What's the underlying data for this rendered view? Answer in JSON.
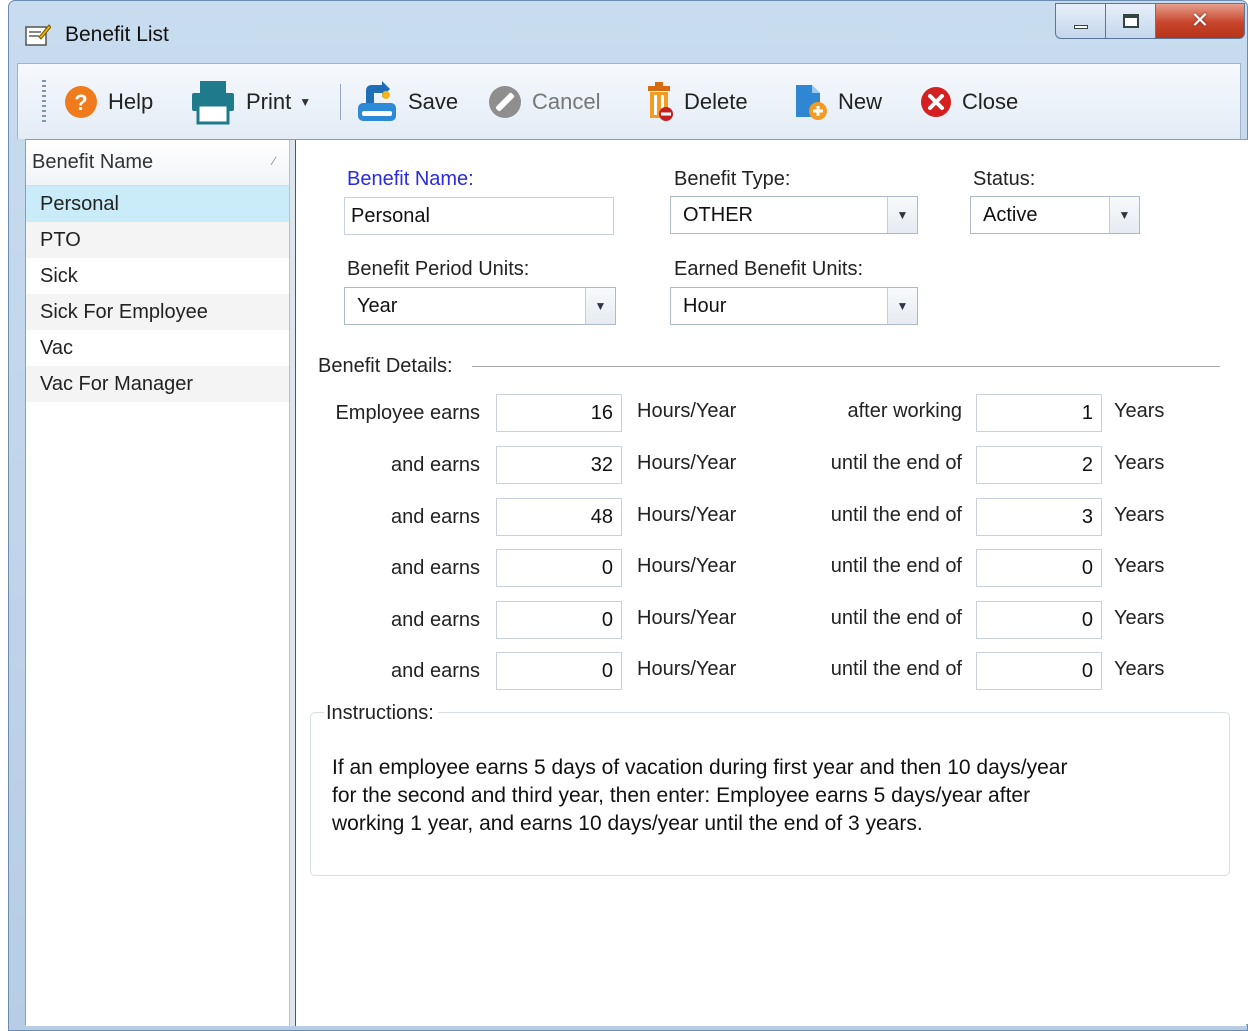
{
  "window": {
    "title": "Benefit List",
    "accent_color": "#c7452b"
  },
  "toolbar": {
    "help": "Help",
    "print": "Print",
    "save": "Save",
    "cancel": "Cancel",
    "delete": "Delete",
    "new": "New",
    "close": "Close"
  },
  "list": {
    "header": "Benefit Name",
    "items": [
      "Personal",
      "PTO",
      "Sick",
      "Sick For Employee",
      "Vac",
      "Vac For Manager"
    ],
    "selected": "Personal"
  },
  "form": {
    "benefit_name_label": "Benefit Name:",
    "benefit_name_value": "Personal",
    "benefit_type_label": "Benefit Type:",
    "benefit_type_value": "OTHER",
    "status_label": "Status:",
    "status_value": "Active",
    "period_units_label": "Benefit Period Units:",
    "period_units_value": "Year",
    "earned_units_label": "Earned Benefit Units:",
    "earned_units_value": "Hour",
    "details_label": "Benefit Details:",
    "rows": [
      {
        "prefix": "Employee earns",
        "amount": "16",
        "unit": "Hours/Year",
        "condition": "after working",
        "years": "1",
        "years_unit": "Years"
      },
      {
        "prefix": "and earns",
        "amount": "32",
        "unit": "Hours/Year",
        "condition": "until the end of",
        "years": "2",
        "years_unit": "Years"
      },
      {
        "prefix": "and earns",
        "amount": "48",
        "unit": "Hours/Year",
        "condition": "until the end of",
        "years": "3",
        "years_unit": "Years"
      },
      {
        "prefix": "and earns",
        "amount": "0",
        "unit": "Hours/Year",
        "condition": "until the end of",
        "years": "0",
        "years_unit": "Years"
      },
      {
        "prefix": "and earns",
        "amount": "0",
        "unit": "Hours/Year",
        "condition": "until the end of",
        "years": "0",
        "years_unit": "Years"
      },
      {
        "prefix": "and earns",
        "amount": "0",
        "unit": "Hours/Year",
        "condition": "until the end of",
        "years": "0",
        "years_unit": "Years"
      }
    ],
    "instructions_label": "Instructions:",
    "instructions_lines": [
      "If an employee earns 5 days of vacation during first year and then 10 days/year",
      "for the second and third year, then enter: Employee earns 5 days/year after",
      "working 1 year, and earns 10 days/year until the end of 3 years."
    ]
  }
}
